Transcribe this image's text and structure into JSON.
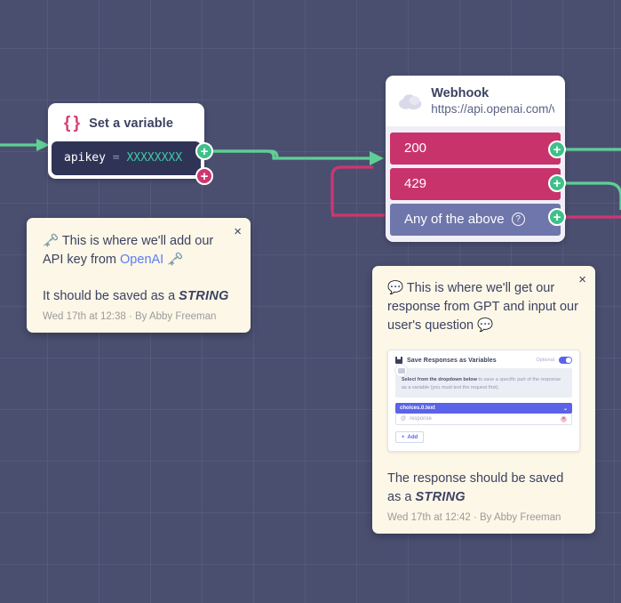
{
  "canvas": {
    "grid_color": "#ffffff0e",
    "background_color": "#4a4f70"
  },
  "nodes": {
    "set_variable": {
      "icon": "curly-braces-icon",
      "title": "Set a variable",
      "variable_name": "apikey",
      "operator": "=",
      "variable_value": "XXXXXXXX",
      "accent_color": "#d73d73",
      "body_color": "#2f3456",
      "value_color": "#3ec9a7",
      "handles": [
        {
          "name": "success-output",
          "label": "+",
          "color": "#3fc08a"
        },
        {
          "name": "failure-output",
          "label": "+",
          "color": "#cf3670"
        }
      ]
    },
    "webhook": {
      "icon": "cloud-icon",
      "title": "Webhook",
      "url": "https://api.openai.com/v",
      "rows": [
        {
          "label": "200",
          "type": "status",
          "color": "#c9336b",
          "handle": "+",
          "has_help": false
        },
        {
          "label": "429",
          "type": "status",
          "color": "#c9336b",
          "handle": "+",
          "has_help": false
        },
        {
          "label": "Any of the above",
          "type": "any",
          "color": "#6f76ab",
          "handle": "+",
          "has_help": true,
          "help_icon": "question-circle-icon"
        }
      ]
    }
  },
  "comments": [
    {
      "id": "api-key-comment",
      "close_label": "×",
      "emoji_lead": "🗝️",
      "text_before_link": " This is where we'll add our API key from ",
      "link_text": "OpenAI",
      "emoji_trail": " 🗝️",
      "note_prefix": "It should be saved as a ",
      "note_emphasis": "STRING",
      "meta": "Wed 17th at 12:38 · By Abby Freeman"
    },
    {
      "id": "gpt-response-comment",
      "close_label": "×",
      "emoji_lead": "💬",
      "text": " This is where we'll get our response from GPT and input our user's question ",
      "emoji_trail": "💬",
      "note_prefix": "The response should be saved as a ",
      "note_emphasis": "STRING",
      "meta": "Wed 17th at 12:42 · By Abby Freeman",
      "screenshot": {
        "icon": "floppy-disk-icon",
        "title": "Save Responses as Variables",
        "optional_label": "Optional",
        "toggle_state": "on",
        "info_bold": "Select from the dropdown below",
        "info_rest": " to save a specific part of the response as a variable (you must test the request first).",
        "select_value": "choices.0.text",
        "select_chevron": "⌄",
        "field_prefix": "@",
        "field_value": "response",
        "delete_icon": "delete-icon",
        "add_label": "Add",
        "add_icon": "plus-icon",
        "accent_color": "#5b63e8"
      }
    }
  ],
  "connectors": [
    {
      "name": "input-to-setvar",
      "color": "#5fcf95",
      "has_arrow": true
    },
    {
      "name": "setvar-to-webhook",
      "color": "#5fcf95",
      "has_arrow": true
    },
    {
      "name": "setvar-error-loop",
      "color": "#cf3670",
      "has_arrow": false
    },
    {
      "name": "webhook-200-out",
      "color": "#5fcf95",
      "has_arrow": false
    },
    {
      "name": "webhook-429-out",
      "color": "#5fcf95",
      "has_arrow": false
    },
    {
      "name": "webhook-any-out",
      "color": "#cf3670",
      "has_arrow": false
    }
  ]
}
